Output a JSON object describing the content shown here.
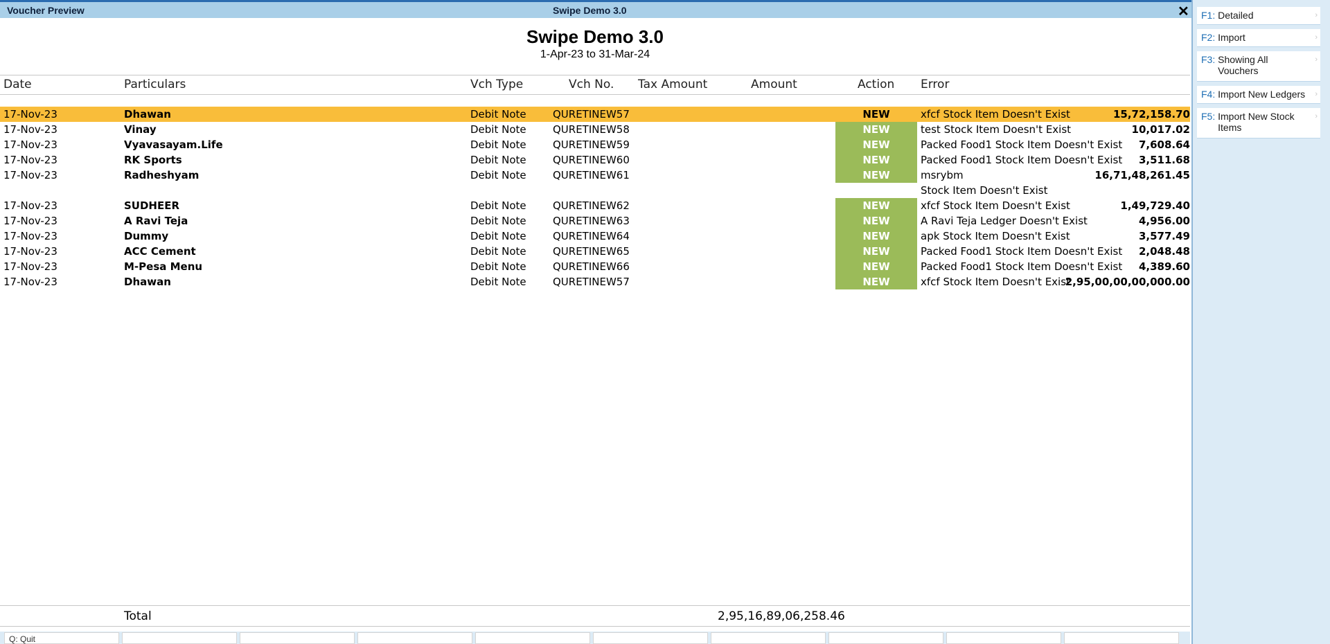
{
  "window": {
    "left_title": "Voucher Preview",
    "center_title": "Swipe Demo 3.0",
    "close_glyph": "✕"
  },
  "report": {
    "title": "Swipe Demo 3.0",
    "period": "1-Apr-23 to 31-Mar-24"
  },
  "columns": {
    "date": "Date",
    "particulars": "Particulars",
    "vch_type": "Vch Type",
    "vch_no": "Vch No.",
    "tax_amount": "Tax Amount",
    "amount": "Amount",
    "action": "Action",
    "error": "Error"
  },
  "rows": [
    {
      "date": "17-Nov-23",
      "particulars": "Dhawan",
      "vch_type": "Debit Note",
      "vch_no": "QURETINEW57",
      "amount": "15,72,158.70",
      "action": "NEW",
      "error": "xfcf Stock Item Doesn't Exist"
    },
    {
      "date": "17-Nov-23",
      "particulars": "Vinay",
      "vch_type": "Debit Note",
      "vch_no": "QURETINEW58",
      "amount": "10,017.02",
      "action": "NEW",
      "error": "test Stock Item Doesn't Exist"
    },
    {
      "date": "17-Nov-23",
      "particulars": "Vyavasayam.Life",
      "vch_type": "Debit Note",
      "vch_no": "QURETINEW59",
      "amount": "7,608.64",
      "action": "NEW",
      "error": "Packed Food1 Stock Item Doesn't Exist"
    },
    {
      "date": "17-Nov-23",
      "particulars": "RK Sports",
      "vch_type": "Debit Note",
      "vch_no": "QURETINEW60",
      "amount": "3,511.68",
      "action": "NEW",
      "error": "Packed Food1 Stock Item Doesn't Exist"
    },
    {
      "date": "17-Nov-23",
      "particulars": "Radheshyam",
      "vch_type": "Debit Note",
      "vch_no": "QURETINEW61",
      "amount": "16,71,48,261.45",
      "action": "NEW",
      "error": "msrybm",
      "error_line2": " Stock Item Doesn't Exist"
    },
    {
      "date": "17-Nov-23",
      "particulars": "SUDHEER",
      "vch_type": "Debit Note",
      "vch_no": "QURETINEW62",
      "amount": "1,49,729.40",
      "action": "NEW",
      "error": "xfcf Stock Item Doesn't Exist"
    },
    {
      "date": "17-Nov-23",
      "particulars": "A Ravi Teja",
      "vch_type": "Debit Note",
      "vch_no": "QURETINEW63",
      "amount": "4,956.00",
      "action": "NEW",
      "error": "A Ravi Teja Ledger Doesn't Exist"
    },
    {
      "date": "17-Nov-23",
      "particulars": "Dummy",
      "vch_type": "Debit Note",
      "vch_no": "QURETINEW64",
      "amount": "3,577.49",
      "action": "NEW",
      "error": "apk Stock Item Doesn't Exist"
    },
    {
      "date": "17-Nov-23",
      "particulars": "ACC Cement",
      "vch_type": "Debit Note",
      "vch_no": "QURETINEW65",
      "amount": "2,048.48",
      "action": "NEW",
      "error": "Packed Food1 Stock Item Doesn't Exist"
    },
    {
      "date": "17-Nov-23",
      "particulars": "M-Pesa Menu",
      "vch_type": "Debit Note",
      "vch_no": "QURETINEW66",
      "amount": "4,389.60",
      "action": "NEW",
      "error": "Packed Food1 Stock Item Doesn't Exist"
    },
    {
      "date": "17-Nov-23",
      "particulars": "Dhawan",
      "vch_type": "Debit Note",
      "vch_no": "QURETINEW57",
      "amount": "2,95,00,00,00,000.00",
      "action": "NEW",
      "error": "xfcf Stock Item Doesn't Exist"
    }
  ],
  "total": {
    "label": "Total",
    "amount": "2,95,16,89,06,258.46"
  },
  "bottom": {
    "quit": "Q: Quit"
  },
  "sidebar": [
    {
      "key": "F1:",
      "label": "Detailed"
    },
    {
      "key": "F2:",
      "label": "Import"
    },
    {
      "key": "F3:",
      "label": "Showing All Vouchers"
    },
    {
      "key": "F4:",
      "label": "Import New Ledgers"
    },
    {
      "key": "F5:",
      "label": "Import New Stock Items"
    }
  ],
  "colors": {
    "selected_row": "#f9bd3a",
    "action_badge": "#9bbb59",
    "title_bar": "#a9cfe8",
    "sidebar_bg": "#dcebf6"
  }
}
